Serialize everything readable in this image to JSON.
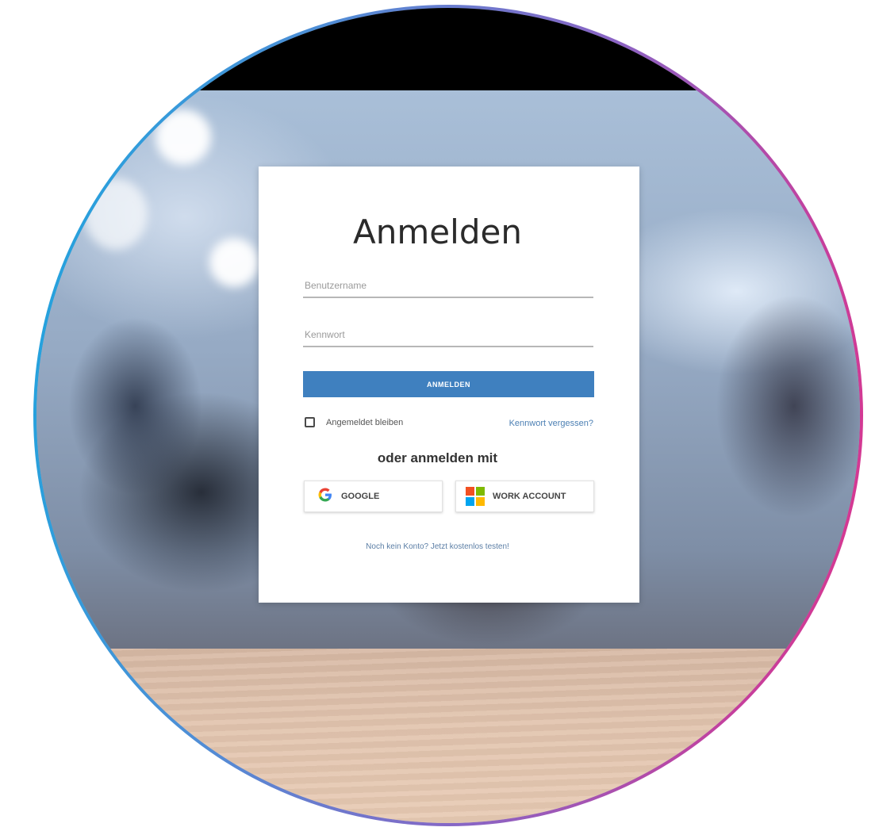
{
  "login": {
    "title": "Anmelden",
    "username_placeholder": "Benutzername",
    "password_placeholder": "Kennwort",
    "submit_label": "ANMELDEN",
    "remember_label": "Angemeldet bleiben",
    "forgot_label": "Kennwort vergessen?",
    "alt_heading": "oder anmelden mit",
    "google_label": "GOOGLE",
    "work_label": "WORK ACCOUNT",
    "signup_label": "Noch kein Konto? Jetzt kostenlos testen!"
  },
  "icons": {
    "google": "google-icon",
    "microsoft": "microsoft-icon"
  },
  "colors": {
    "primary": "#3f80bf",
    "link": "#4b7fb3",
    "ring_start": "#1aa7df",
    "ring_end": "#e0338a"
  }
}
